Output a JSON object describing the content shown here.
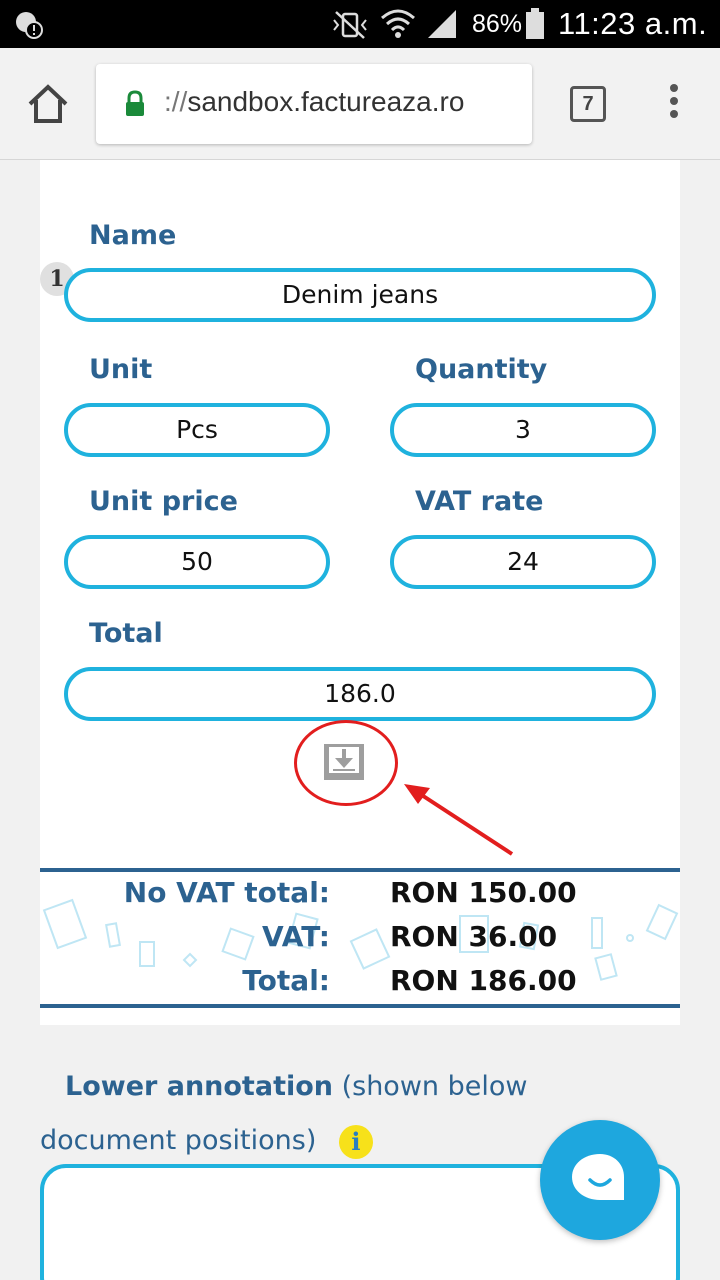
{
  "status_bar": {
    "battery": "86%",
    "time": "11:23 a.m."
  },
  "browser": {
    "url_scheme": "://",
    "url_host": "sandbox.factureaza.ro",
    "tab_count": "7"
  },
  "form": {
    "position_number": "1",
    "name_label": "Name",
    "name_value": "Denim jeans",
    "unit_label": "Unit",
    "unit_value": "Pcs",
    "quantity_label": "Quantity",
    "quantity_value": "3",
    "unit_price_label": "Unit price",
    "unit_price_value": "50",
    "vat_rate_label": "VAT rate",
    "vat_rate_value": "24",
    "total_label": "Total",
    "total_value": "186.0"
  },
  "totals": {
    "no_vat_label": "No VAT total:",
    "no_vat_value": "RON 150.00",
    "vat_label": "VAT:",
    "vat_value": "RON 36.00",
    "total_label": "Total:",
    "total_value": "RON 186.00"
  },
  "lower_annotation": {
    "title": "Lower annotation",
    "hint": "(shown below document positions)",
    "info": "i"
  },
  "colors": {
    "accent_blue": "#1fb2de",
    "label_blue": "#2c6290",
    "annotation_red": "#e21e1e",
    "chat_blue": "#1ea7de"
  }
}
